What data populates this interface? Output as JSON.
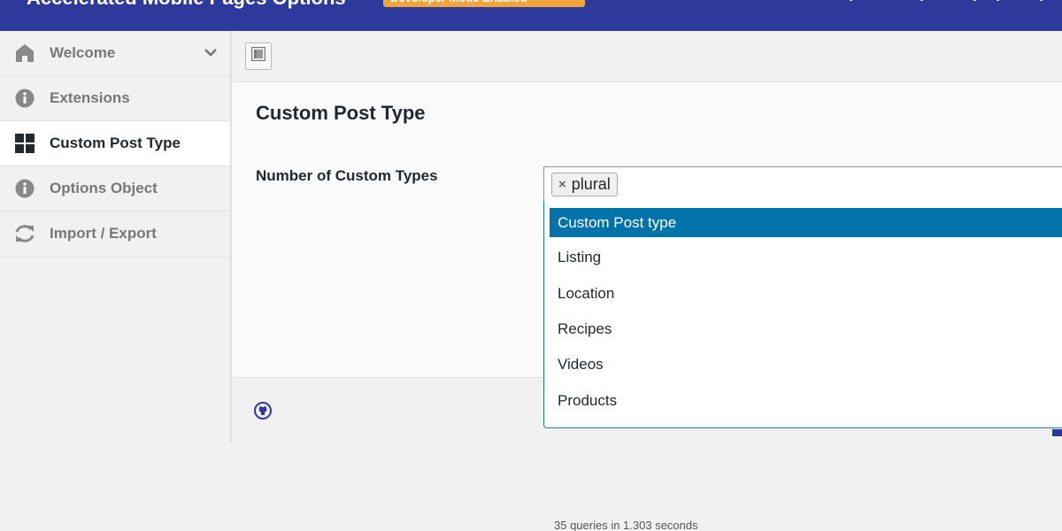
{
  "header": {
    "title": "Accelerated Mobile Pages Options",
    "badge": "Developer Mode Enabled"
  },
  "sidebar": {
    "items": [
      {
        "label": "Welcome",
        "icon": "home-icon",
        "active": false
      },
      {
        "label": "Extensions",
        "icon": "info-icon",
        "active": false
      },
      {
        "label": "Custom Post Type",
        "icon": "grid-icon",
        "active": true
      },
      {
        "label": "Options Object",
        "icon": "info-icon",
        "active": false
      },
      {
        "label": "Import / Export",
        "icon": "refresh-icon",
        "active": false
      }
    ]
  },
  "main": {
    "section_title": "Custom Post Type",
    "field_label": "Number of Custom Types",
    "selected_tags": [
      "plural"
    ],
    "remove_glyph": "×",
    "options": [
      "Custom Post type",
      "Listing",
      "Location",
      "Recipes",
      "Videos",
      "Products"
    ],
    "highlighted_option": "Custom Post type"
  },
  "footer": {
    "stats": "35 queries in 1.303 seconds"
  },
  "colors": {
    "header_bg": "#2d3a9c",
    "badge_bg": "#f0a43a",
    "highlight": "#0073aa",
    "dropdown_border": "#1e7ab8"
  }
}
